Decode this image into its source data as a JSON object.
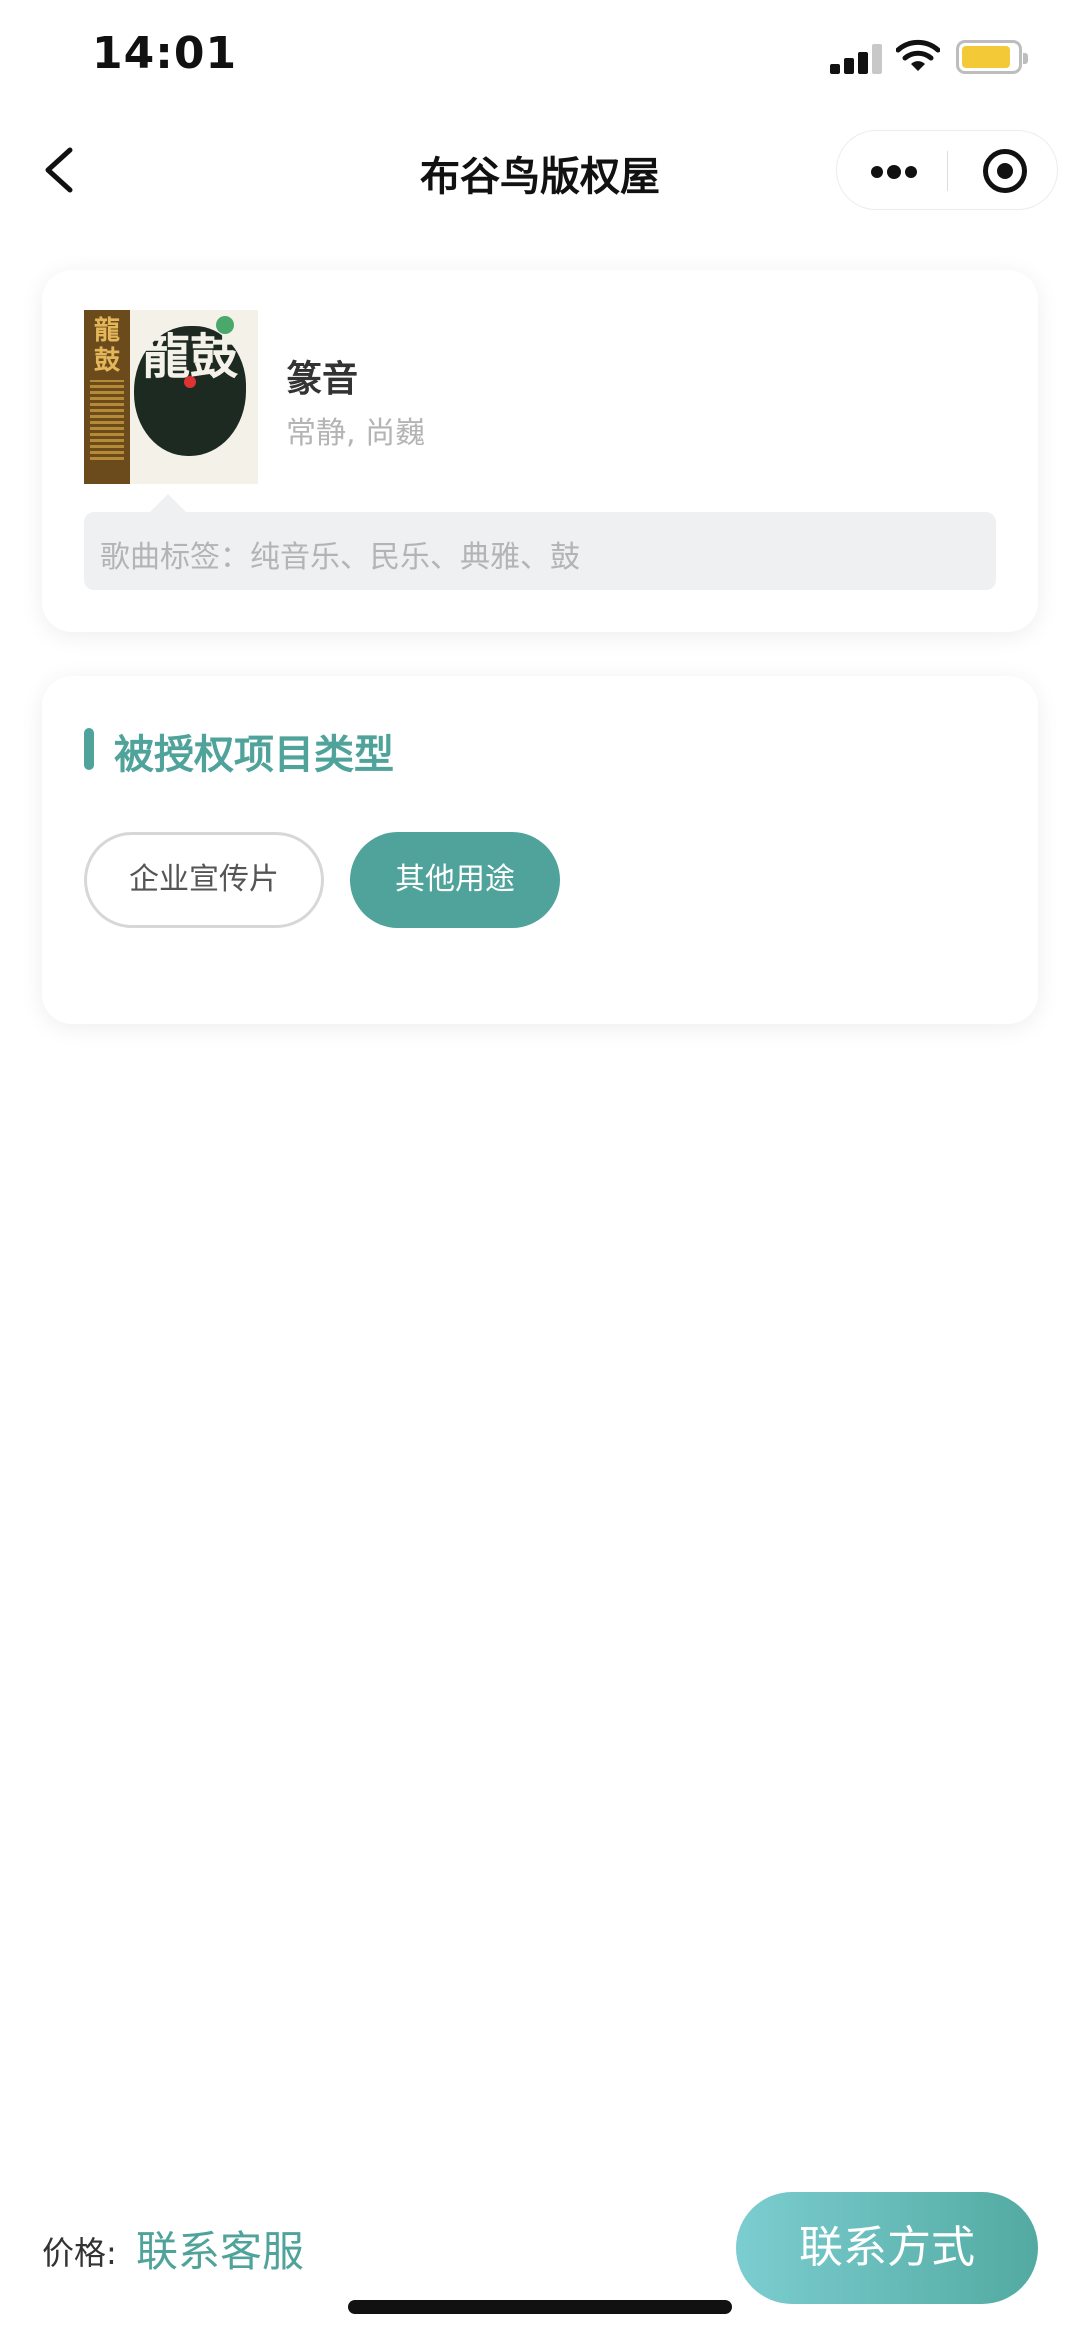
{
  "status_bar": {
    "time": "14:01"
  },
  "nav": {
    "title": "布谷鸟版权屋"
  },
  "song": {
    "cover_spine_text": "龍鼓",
    "cover_title": "龍鼓",
    "title": "篆音",
    "artist": "常静, 尚巍",
    "tags": "歌曲标签：纯音乐、民乐、典雅、鼓"
  },
  "license": {
    "section_title": "被授权项目类型",
    "options": [
      {
        "label": "企业宣传片",
        "selected": false
      },
      {
        "label": "其他用途",
        "selected": true
      }
    ]
  },
  "footer": {
    "price_label": "价格:",
    "price_value": "联系客服",
    "contact_button": "联系方式"
  },
  "colors": {
    "accent": "#4fa39a",
    "button_gradient_start": "#7ccdd0",
    "button_gradient_end": "#52aaa1",
    "battery": "#f3c938"
  },
  "icons": [
    "back-arrow-icon",
    "more-dots-icon",
    "target-icon",
    "signal-icon",
    "wifi-icon",
    "battery-icon"
  ]
}
